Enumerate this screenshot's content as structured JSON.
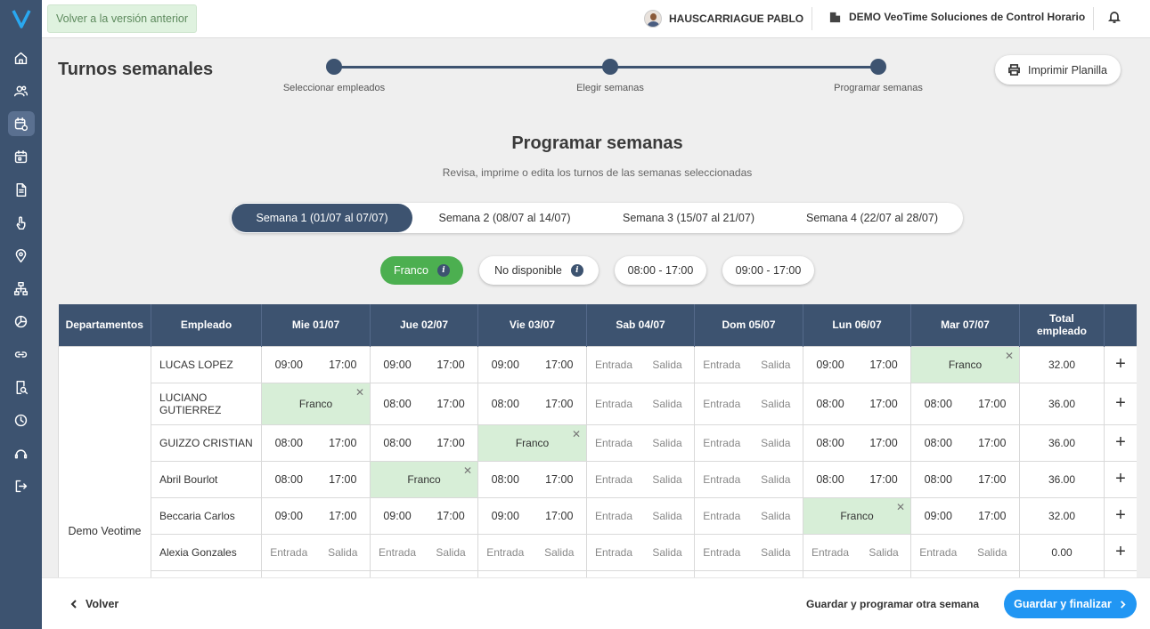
{
  "topbar": {
    "prev_version": "Volver a la versión anterior",
    "user_name": "HAUSCARRIAGUE PABLO",
    "company": "DEMO VeoTime Soluciones de Control Horario"
  },
  "header": {
    "title": "Turnos semanales",
    "steps": [
      "Seleccionar empleados",
      "Elegir semanas",
      "Programar semanas"
    ],
    "print_label": "Imprimir Planilla"
  },
  "section": {
    "title": "Programar semanas",
    "subtitle": "Revisa, imprime o edita los turnos de las semanas seleccionadas"
  },
  "weeks": [
    "Semana 1 (01/07 al 07/07)",
    "Semana 2 (08/07 al 14/07)",
    "Semana 3 (15/07 al 21/07)",
    "Semana 4 (22/07 al 28/07)"
  ],
  "chips": [
    "Franco",
    "No disponible",
    "08:00 - 17:00",
    "09:00 - 17:00"
  ],
  "table": {
    "headers": [
      "Departamentos",
      "Empleado",
      "Mie 01/07",
      "Jue 02/07",
      "Vie 03/07",
      "Sab 04/07",
      "Dom 05/07",
      "Lun 06/07",
      "Mar 07/07",
      "Total empleado"
    ],
    "department": "Demo Veotime",
    "franco_label": "Franco",
    "entrada_label": "Entrada",
    "salida_label": "Salida",
    "rows": [
      {
        "employee": "LUCAS LOPEZ",
        "total": "32.00",
        "days": [
          [
            "09:00",
            "17:00"
          ],
          [
            "09:00",
            "17:00"
          ],
          [
            "09:00",
            "17:00"
          ],
          null,
          null,
          [
            "09:00",
            "17:00"
          ],
          "F"
        ]
      },
      {
        "employee": "LUCIANO GUTIERREZ",
        "total": "36.00",
        "days": [
          "F",
          [
            "08:00",
            "17:00"
          ],
          [
            "08:00",
            "17:00"
          ],
          null,
          null,
          [
            "08:00",
            "17:00"
          ],
          [
            "08:00",
            "17:00"
          ]
        ]
      },
      {
        "employee": "GUIZZO CRISTIAN",
        "total": "36.00",
        "days": [
          [
            "08:00",
            "17:00"
          ],
          [
            "08:00",
            "17:00"
          ],
          "F",
          null,
          null,
          [
            "08:00",
            "17:00"
          ],
          [
            "08:00",
            "17:00"
          ]
        ]
      },
      {
        "employee": "Abril Bourlot",
        "total": "36.00",
        "days": [
          [
            "08:00",
            "17:00"
          ],
          "F",
          [
            "08:00",
            "17:00"
          ],
          null,
          null,
          [
            "08:00",
            "17:00"
          ],
          [
            "08:00",
            "17:00"
          ]
        ]
      },
      {
        "employee": "Beccaria Carlos",
        "total": "32.00",
        "days": [
          [
            "09:00",
            "17:00"
          ],
          [
            "09:00",
            "17:00"
          ],
          [
            "09:00",
            "17:00"
          ],
          null,
          null,
          "F",
          [
            "09:00",
            "17:00"
          ]
        ]
      },
      {
        "employee": "Alexia Gonzales",
        "total": "0.00",
        "days": [
          null,
          null,
          null,
          null,
          null,
          null,
          null
        ]
      }
    ]
  },
  "bottom": {
    "back": "Volver",
    "save_other": "Guardar y programar otra semana",
    "finish": "Guardar y finalizar"
  },
  "colors": {
    "sidebar": "#3d5370",
    "franco_bg": "#d7eed7",
    "green": "#4caf50",
    "primary": "#2196f3"
  }
}
